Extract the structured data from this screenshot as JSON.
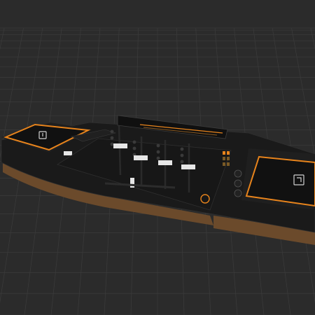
{
  "scene": {
    "subject": "dj-controller-3d-model",
    "background_color": "#2b2b2b",
    "grid_color": "#3a3a3a",
    "accent_color": "#e8841c",
    "body_color": "#1a1a1a",
    "wood_color": "#6b4a2b",
    "fader_cap_color": "#e6e6e6",
    "icons": {
      "left_platter": "power-icon",
      "right_platter": "sync-icon"
    }
  }
}
